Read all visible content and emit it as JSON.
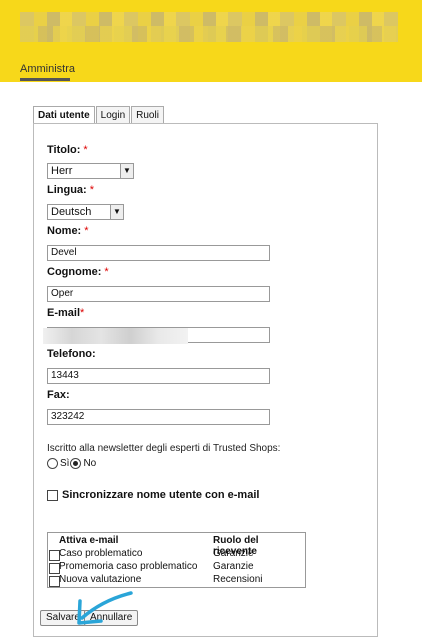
{
  "header": {
    "nav_label": "Amministra",
    "accent": "#f7d81a"
  },
  "tabs": [
    "Dati utente",
    "Login",
    "Ruoli"
  ],
  "form": {
    "titolo": {
      "label": "Titolo:",
      "required": "*",
      "value": "Herr"
    },
    "lingua": {
      "label": "Lingua:",
      "required": "*",
      "value": "Deutsch"
    },
    "nome": {
      "label": "Nome:",
      "required": "*",
      "value": "Devel"
    },
    "cognome": {
      "label": "Cognome:",
      "required": "*",
      "value": "Oper"
    },
    "email": {
      "label": "E-mail",
      "required": "*",
      "value": ""
    },
    "telefono": {
      "label": "Telefono:",
      "value": "13443"
    },
    "fax": {
      "label": "Fax:",
      "value": "323242"
    },
    "newsletter": {
      "question": "Iscritto alla newsletter degli esperti di Trusted Shops:",
      "opt_si": "Sì",
      "opt_no": "No",
      "selected": "No"
    },
    "sync_label": "Sincronizzare nome utente con e-mail"
  },
  "email_table": {
    "headers": [
      "Attiva e-mail",
      "Ruolo del ricevente"
    ],
    "rows": [
      {
        "name": "Caso problematico",
        "role": "Garanzie"
      },
      {
        "name": "Promemoria caso problematico",
        "role": "Garanzie"
      },
      {
        "name": "Nuova valutazione",
        "role": "Recensioni"
      }
    ]
  },
  "buttons": {
    "save": "Salvare",
    "cancel": "Annullare"
  }
}
